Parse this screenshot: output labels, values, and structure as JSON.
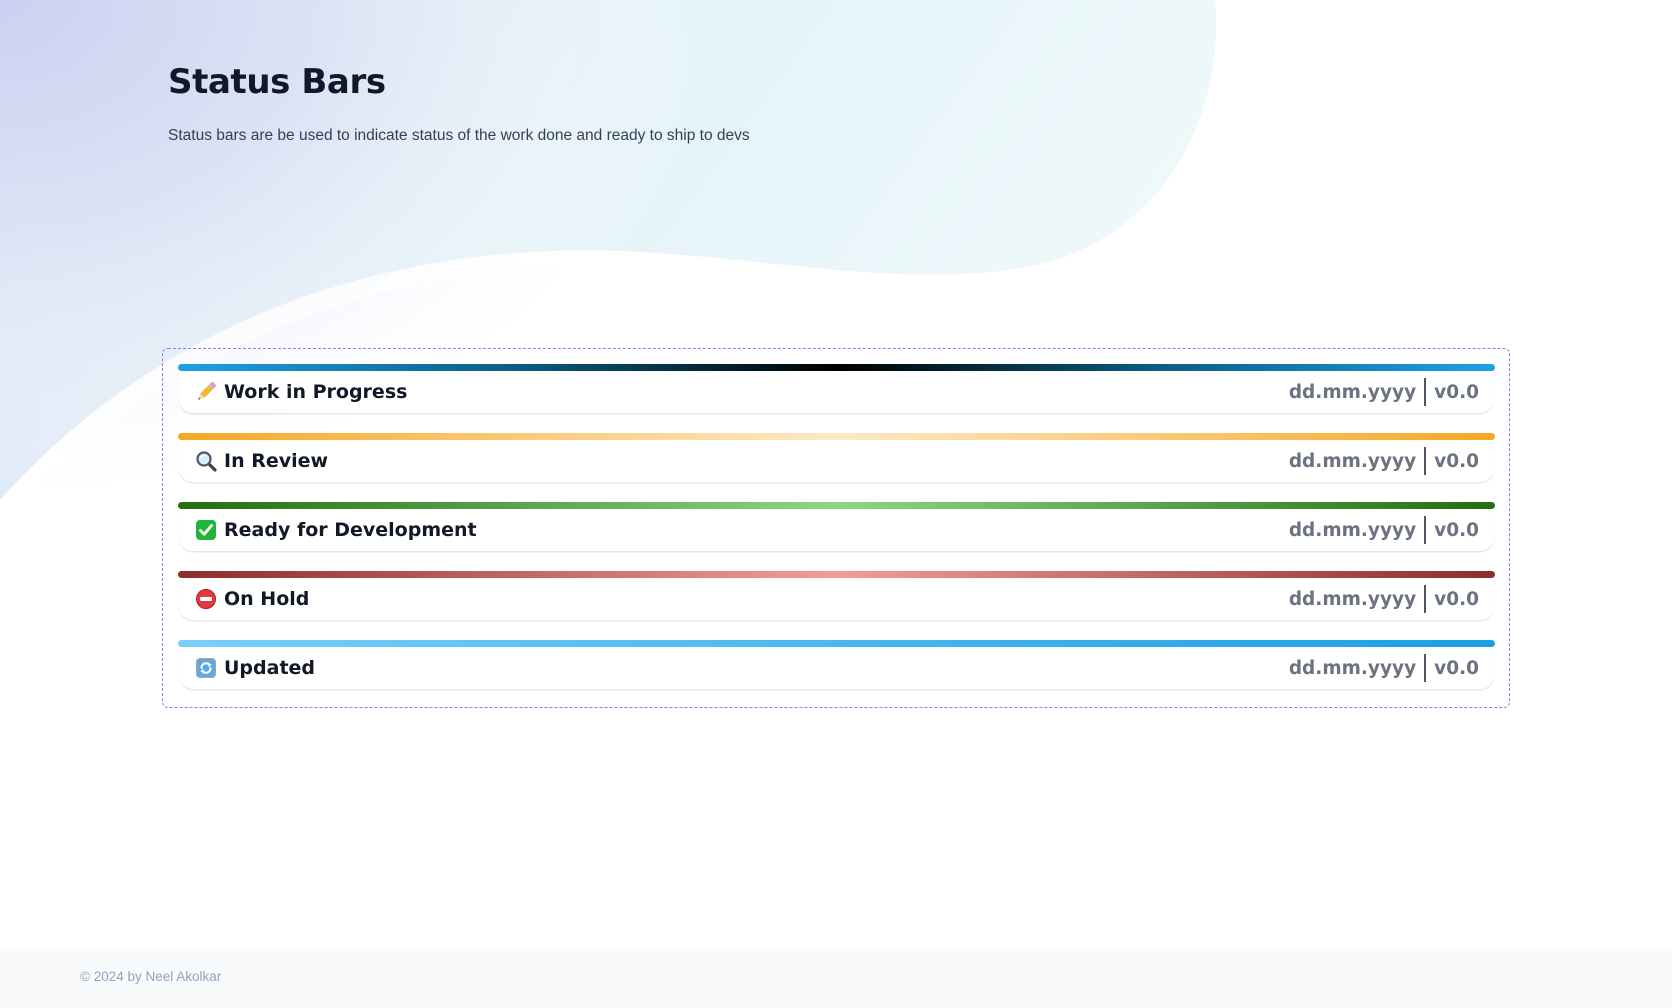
{
  "page": {
    "title": "Status Bars",
    "subtitle": "Status bars are be used to indicate status of the work done and ready to ship to devs"
  },
  "statuses": [
    {
      "label": "Work in Progress",
      "icon": "pencil-icon",
      "date": "dd.mm.yyyy",
      "version": "v0.0",
      "bar_colors": [
        "#1da1e7",
        "#0b5f86",
        "#000000",
        "#0b5f86",
        "#1da1e7"
      ]
    },
    {
      "label": "In Review",
      "icon": "magnifier-icon",
      "date": "dd.mm.yyyy",
      "version": "v0.0",
      "bar_colors": [
        "#f6a823",
        "#fde9c6",
        "#f6a823"
      ]
    },
    {
      "label": "Ready for Development",
      "icon": "check-icon",
      "date": "dd.mm.yyyy",
      "version": "v0.0",
      "bar_colors": [
        "#256c12",
        "#8fd77f",
        "#256c12"
      ]
    },
    {
      "label": "On Hold",
      "icon": "no-entry-icon",
      "date": "dd.mm.yyyy",
      "version": "v0.0",
      "bar_colors": [
        "#8d2c2c",
        "#f39b9b",
        "#8d2c2c"
      ]
    },
    {
      "label": "Updated",
      "icon": "refresh-icon",
      "date": "dd.mm.yyyy",
      "version": "v0.0",
      "bar_colors": [
        "#79cff9",
        "#1b9fe2"
      ]
    }
  ],
  "footer": {
    "text": "© 2024 by Neel Akolkar"
  },
  "colors": {
    "panel_border": "#8b7cf6",
    "bg_lavender": "#cfd3f4",
    "bg_aqua": "#e7f7f9"
  }
}
